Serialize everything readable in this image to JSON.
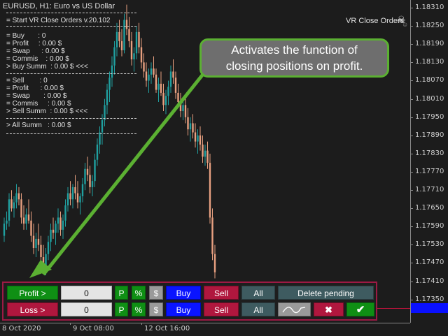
{
  "header": {
    "symbol_title": "EURUSD, H1:  Euro vs US Dollar",
    "ea_name": "VR Close Orders"
  },
  "info_panel": {
    "lines": [
      "= Start VR Close Orders v.20.102",
      "= Buy       : 0",
      "= Profit     : 0.00 $",
      "= Swap      : 0.00 $",
      "= Commis    : 0.00 $",
      "> Buy Summ  : 0.00 $ <<<",
      "= Sell        : 0",
      "= Profit      : 0.00 $",
      "= Swap       : 0.00 $",
      "= Commis     : 0.00 $",
      "> Sell Summ  : 0.00 $ <<<",
      "> All Summ   : 0.00 $"
    ]
  },
  "callout": {
    "line1": "Activates the function of",
    "line2": "closing positions on profit."
  },
  "price_axis": {
    "ticks": [
      "1.18310",
      "1.18250",
      "1.18190",
      "1.18130",
      "1.18070",
      "1.18010",
      "1.17950",
      "1.17890",
      "1.17830",
      "1.17770",
      "1.17710",
      "1.17650",
      "1.17590",
      "1.17530",
      "1.17470",
      "1.17410",
      "1.17350"
    ]
  },
  "time_axis": {
    "labels": [
      "8 Oct 2020",
      "9 Oct 08:00",
      "12 Oct 16:00"
    ]
  },
  "controls": {
    "row1": {
      "profit_label": "Profit >",
      "profit_value": "0",
      "p_label": "P",
      "pct_label": "%",
      "usd_label": "$",
      "buy_label": "Buy",
      "sell_label": "Sell",
      "all_label": "All",
      "delete_pending_label": "Delete pending"
    },
    "row2": {
      "loss_label": "Loss >",
      "loss_value": "0",
      "p_label": "P",
      "pct_label": "%",
      "usd_label": "$",
      "buy_label": "Buy",
      "sell_label": "Sell",
      "all_label": "All",
      "trail_icon": "trailing-line-icon",
      "close_icon": "close-x-icon",
      "confirm_icon": "checkmark-icon"
    }
  },
  "colors": {
    "bull_candle": "#20a0a0",
    "bear_candle": "#e8a080",
    "callout_border": "#5bb032",
    "panel_border": "#9c1a44"
  },
  "candles": [
    [
      1.1756,
      1.1762,
      1.1754,
      1.176
    ],
    [
      1.176,
      1.1764,
      1.1758,
      1.1761
    ],
    [
      1.1761,
      1.177,
      1.1759,
      1.1768
    ],
    [
      1.1768,
      1.1771,
      1.1764,
      1.1765
    ],
    [
      1.1765,
      1.1769,
      1.1762,
      1.1767
    ],
    [
      1.1767,
      1.1773,
      1.1765,
      1.177
    ],
    [
      1.177,
      1.1772,
      1.1766,
      1.1768
    ],
    [
      1.1768,
      1.177,
      1.176,
      1.1762
    ],
    [
      1.1762,
      1.1766,
      1.1758,
      1.176
    ],
    [
      1.176,
      1.1765,
      1.1758,
      1.1763
    ],
    [
      1.1763,
      1.1768,
      1.176,
      1.1761
    ],
    [
      1.1761,
      1.1764,
      1.1754,
      1.1756
    ],
    [
      1.1756,
      1.176,
      1.175,
      1.1752
    ],
    [
      1.1752,
      1.1757,
      1.1749,
      1.1755
    ],
    [
      1.1755,
      1.176,
      1.1751,
      1.1753
    ],
    [
      1.1753,
      1.1756,
      1.1747,
      1.1749
    ],
    [
      1.1749,
      1.1753,
      1.1744,
      1.1746
    ],
    [
      1.1746,
      1.1752,
      1.1743,
      1.175
    ],
    [
      1.175,
      1.1756,
      1.1748,
      1.1754
    ],
    [
      1.1754,
      1.176,
      1.1751,
      1.1758
    ],
    [
      1.1758,
      1.1762,
      1.1755,
      1.1757
    ],
    [
      1.1757,
      1.1761,
      1.1753,
      1.176
    ],
    [
      1.176,
      1.1765,
      1.1757,
      1.1762
    ],
    [
      1.1762,
      1.1764,
      1.1756,
      1.1758
    ],
    [
      1.1758,
      1.1763,
      1.1755,
      1.1761
    ],
    [
      1.1761,
      1.1768,
      1.1759,
      1.1766
    ],
    [
      1.1766,
      1.1772,
      1.1764,
      1.177
    ],
    [
      1.177,
      1.1774,
      1.1766,
      1.1768
    ],
    [
      1.1768,
      1.1773,
      1.1765,
      1.1772
    ],
    [
      1.1772,
      1.1776,
      1.1768,
      1.177
    ],
    [
      1.177,
      1.1774,
      1.1765,
      1.1767
    ],
    [
      1.1767,
      1.177,
      1.1763,
      1.1769
    ],
    [
      1.1769,
      1.1775,
      1.1767,
      1.1773
    ],
    [
      1.1773,
      1.178,
      1.1771,
      1.1778
    ],
    [
      1.1778,
      1.1782,
      1.1774,
      1.1776
    ],
    [
      1.1776,
      1.1779,
      1.177,
      1.1772
    ],
    [
      1.1772,
      1.1776,
      1.1769,
      1.1774
    ],
    [
      1.1774,
      1.1783,
      1.1772,
      1.1781
    ],
    [
      1.1781,
      1.1788,
      1.1779,
      1.1786
    ],
    [
      1.1786,
      1.1792,
      1.1783,
      1.179
    ],
    [
      1.179,
      1.1796,
      1.1786,
      1.1794
    ],
    [
      1.1794,
      1.1801,
      1.1792,
      1.1799
    ],
    [
      1.1799,
      1.1806,
      1.1796,
      1.1804
    ],
    [
      1.1804,
      1.181,
      1.18,
      1.1808
    ],
    [
      1.1808,
      1.1815,
      1.1805,
      1.1812
    ],
    [
      1.1812,
      1.182,
      1.1809,
      1.1818
    ],
    [
      1.1818,
      1.1826,
      1.1815,
      1.1823
    ],
    [
      1.1823,
      1.1827,
      1.1818,
      1.182
    ],
    [
      1.182,
      1.1824,
      1.1815,
      1.1817
    ],
    [
      1.1817,
      1.1829,
      1.1816,
      1.1827
    ],
    [
      1.1827,
      1.1832,
      1.1822,
      1.1824
    ],
    [
      1.1824,
      1.1828,
      1.1818,
      1.182
    ],
    [
      1.182,
      1.1823,
      1.1812,
      1.1814
    ],
    [
      1.1814,
      1.1818,
      1.181,
      1.1816
    ],
    [
      1.1816,
      1.1825,
      1.1814,
      1.1823
    ],
    [
      1.1823,
      1.1826,
      1.1816,
      1.1818
    ],
    [
      1.1818,
      1.1821,
      1.1811,
      1.1813
    ],
    [
      1.1813,
      1.1816,
      1.1808,
      1.181
    ],
    [
      1.181,
      1.1813,
      1.1805,
      1.1807
    ],
    [
      1.1807,
      1.1811,
      1.1803,
      1.1809
    ],
    [
      1.1809,
      1.1813,
      1.1806,
      1.1811
    ],
    [
      1.1811,
      1.1815,
      1.1808,
      1.1809
    ],
    [
      1.1809,
      1.1811,
      1.1803,
      1.1804
    ],
    [
      1.1804,
      1.1808,
      1.18,
      1.1806
    ],
    [
      1.1806,
      1.181,
      1.1802,
      1.1803
    ],
    [
      1.1803,
      1.1806,
      1.1797,
      1.1799
    ],
    [
      1.1799,
      1.1804,
      1.1796,
      1.1802
    ],
    [
      1.1802,
      1.1807,
      1.1799,
      1.1805
    ],
    [
      1.1805,
      1.1812,
      1.1803,
      1.181
    ],
    [
      1.181,
      1.1814,
      1.1806,
      1.1808
    ],
    [
      1.1808,
      1.181,
      1.1801,
      1.1803
    ],
    [
      1.1803,
      1.1806,
      1.1798,
      1.18
    ],
    [
      1.18,
      1.1803,
      1.1795,
      1.1797
    ],
    [
      1.1797,
      1.1801,
      1.1794,
      1.1799
    ],
    [
      1.1799,
      1.1802,
      1.1793,
      1.1795
    ],
    [
      1.1795,
      1.1798,
      1.1789,
      1.1791
    ],
    [
      1.1791,
      1.1795,
      1.1787,
      1.1793
    ],
    [
      1.1793,
      1.1796,
      1.1788,
      1.179
    ],
    [
      1.179,
      1.1793,
      1.1785,
      1.1787
    ],
    [
      1.1787,
      1.1791,
      1.1783,
      1.1789
    ],
    [
      1.1789,
      1.1792,
      1.1784,
      1.1786
    ],
    [
      1.1786,
      1.1789,
      1.178,
      1.1782
    ],
    [
      1.1782,
      1.1786,
      1.1779,
      1.1784
    ],
    [
      1.1784,
      1.1787,
      1.1778,
      1.178
    ],
    [
      1.178,
      1.1783,
      1.176,
      1.1762
    ],
    [
      1.1762,
      1.1765,
      1.1748,
      1.175
    ],
    [
      1.175,
      1.1753,
      1.1742,
      1.1744
    ]
  ]
}
